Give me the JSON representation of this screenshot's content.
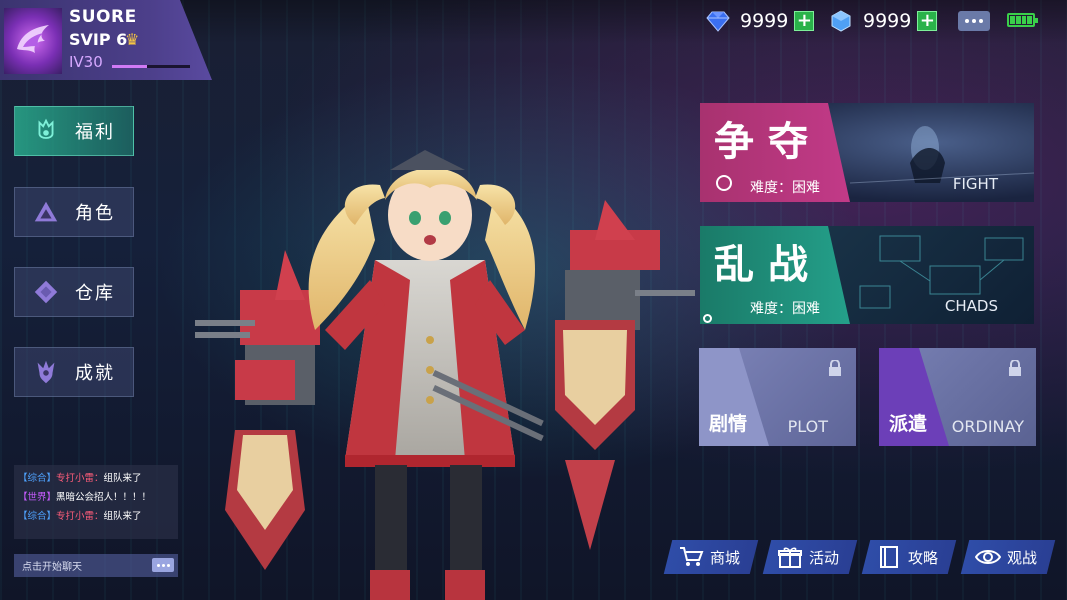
{
  "profile": {
    "name": "SUORE",
    "vip": "SVIP 6",
    "level": "IV30",
    "xp_progress": 0.45
  },
  "currency": [
    {
      "icon": "blue-diamond-icon",
      "value": "9999",
      "color": "#3a6ff0"
    },
    {
      "icon": "crystal-icon",
      "value": "9999",
      "color": "#4fa0f5"
    }
  ],
  "nav": [
    {
      "label": "福利",
      "icon": "gift-flame-icon",
      "active": true
    },
    {
      "label": "角色",
      "icon": "triangle-character-icon",
      "active": false
    },
    {
      "label": "仓库",
      "icon": "diamond-storage-icon",
      "active": false
    },
    {
      "label": "成就",
      "icon": "trophy-flame-icon",
      "active": false
    }
  ],
  "chat": {
    "messages": [
      {
        "channel": "【综合】",
        "user": "专打小雷：",
        "text": "组队来了"
      },
      {
        "channel": "【世界】",
        "user": "",
        "text": "黑暗公会招人！！！！"
      },
      {
        "channel": "【综合】",
        "user": "专打小雷：",
        "text": "组队来了"
      }
    ],
    "input_placeholder": "点击开始聊天"
  },
  "modes": {
    "fight": {
      "title": "争夺",
      "difficulty": "难度：困难",
      "en": "FIGHT",
      "color": "#c23a88"
    },
    "chaos": {
      "title": "乱战",
      "difficulty": "难度：困难",
      "en": "CHADS",
      "color": "#1f8f7a"
    },
    "plot": {
      "title": "剧情",
      "en": "PLOT"
    },
    "dispatch": {
      "title": "派遣",
      "en": "ORDINAY"
    }
  },
  "bottom": [
    {
      "label": "商城",
      "icon": "cart-icon"
    },
    {
      "label": "活动",
      "icon": "gift-box-icon"
    },
    {
      "label": "攻略",
      "icon": "guide-book-icon"
    },
    {
      "label": "观战",
      "icon": "eye-icon"
    }
  ]
}
